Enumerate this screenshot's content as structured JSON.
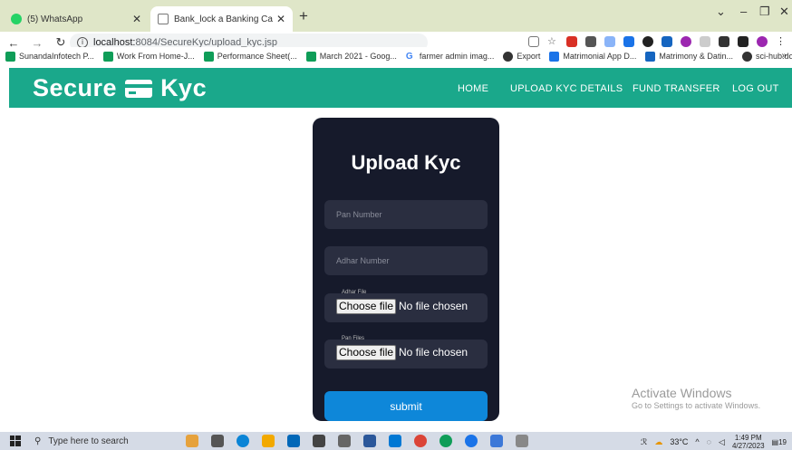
{
  "browser": {
    "tabs": [
      {
        "title": "(5) WhatsApp",
        "active": false,
        "icon": "whatsapp-icon"
      },
      {
        "title": "Bank_lock a Banking Category Fi",
        "active": true,
        "icon": "page-icon"
      }
    ],
    "new_tab": "+",
    "url_host": "localhost:",
    "url_path": "8084/SecureKyc/upload_kyc.jsp",
    "bookmarks": [
      {
        "label": "SunandaInfotech P...",
        "color": "#0f9d58"
      },
      {
        "label": "Work From Home-J...",
        "color": "#0f9d58"
      },
      {
        "label": "Performance Sheet(...",
        "color": "#0f9d58"
      },
      {
        "label": "March 2021 - Goog...",
        "color": "#0f9d58"
      },
      {
        "label": "farmer admin imag...",
        "color": "#4285f4"
      },
      {
        "label": "Export",
        "color": "#333333"
      },
      {
        "label": "Matrimonial App D...",
        "color": "#1a73e8"
      },
      {
        "label": "Matrimony & Datin...",
        "color": "#1565c0"
      },
      {
        "label": "sci-hub.do",
        "color": "#333333"
      }
    ],
    "bookmarks_more": "»"
  },
  "site": {
    "brand_left": "Secure",
    "brand_right": "Kyc",
    "accent": "#1aa88b",
    "nav": [
      "HOME",
      "UPLOAD KYC DETAILS",
      "FUND TRANSFER",
      "LOG OUT"
    ]
  },
  "form": {
    "title": "Upload Kyc",
    "pan_placeholder": "Pan Number",
    "adhar_placeholder": "Adhar Number",
    "adhar_file_label": "Adhar File",
    "pan_file_label": "Pan Files",
    "choose_file": "Choose file",
    "no_file": "No file chosen",
    "submit": "submit"
  },
  "watermark": {
    "line1": "Activate Windows",
    "line2": "Go to Settings to activate Windows."
  },
  "taskbar": {
    "search_placeholder": "Type here to search",
    "temperature": "33°C",
    "time": "1:49 PM",
    "date": "4/27/2023",
    "notification_count": "19"
  }
}
